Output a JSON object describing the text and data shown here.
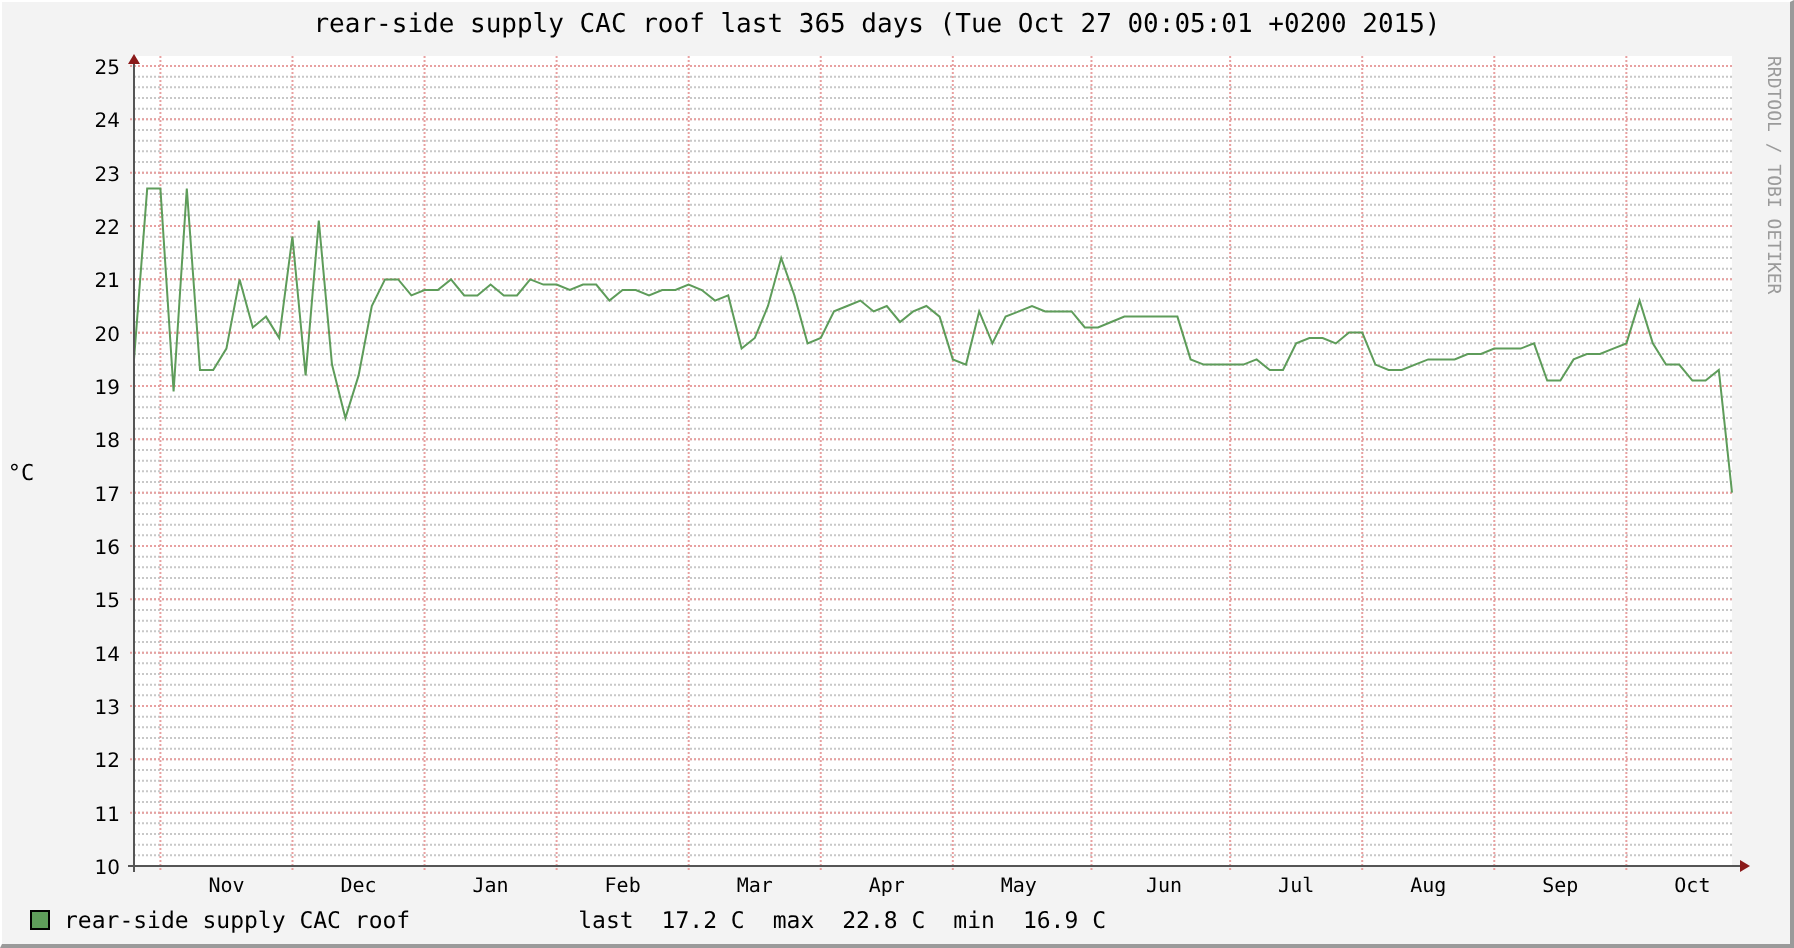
{
  "graph": {
    "credit": "RRDTOOL / TOBI OETIKER",
    "chart_data": {
      "type": "line",
      "title": "rear-side supply CAC roof last 365 days (Tue Oct 27 00:05:01 +0200 2015)",
      "ylabel": "°C",
      "grid": true,
      "categories": [
        null,
        null,
        null,
        null,
        null,
        null,
        null,
        "Nov",
        null,
        null,
        null,
        null,
        null,
        null,
        null,
        null,
        null,
        "Dec",
        null,
        null,
        null,
        null,
        null,
        null,
        null,
        null,
        null,
        "Jan",
        null,
        null,
        null,
        null,
        null,
        null,
        null,
        null,
        null,
        "Feb",
        null,
        null,
        null,
        null,
        null,
        null,
        null,
        null,
        null,
        "Mar",
        null,
        null,
        null,
        null,
        null,
        null,
        null,
        null,
        null,
        "Apr",
        null,
        null,
        null,
        null,
        null,
        null,
        null,
        null,
        null,
        "May",
        null,
        null,
        null,
        null,
        null,
        null,
        null,
        null,
        null,
        null,
        "Jun",
        null,
        null,
        null,
        null,
        null,
        null,
        null,
        null,
        null,
        "Jul",
        null,
        null,
        null,
        null,
        null,
        null,
        null,
        null,
        null,
        "Aug",
        null,
        null,
        null,
        null,
        null,
        null,
        null,
        null,
        null,
        "Sep",
        null,
        null,
        null,
        null,
        null,
        null,
        null,
        null,
        null,
        "Oct",
        null,
        null,
        null
      ],
      "series": [
        {
          "name": "rear-side supply CAC roof",
          "color": "#5e9c5a",
          "values": [
            19.5,
            22.7,
            22.7,
            18.9,
            22.7,
            19.3,
            19.3,
            19.7,
            21.0,
            20.1,
            20.3,
            19.9,
            21.8,
            19.2,
            22.1,
            19.4,
            18.4,
            19.2,
            20.5,
            21.0,
            21.0,
            20.7,
            20.8,
            20.8,
            21.0,
            20.7,
            20.7,
            20.9,
            20.7,
            20.7,
            21.0,
            20.9,
            20.9,
            20.8,
            20.9,
            20.9,
            20.6,
            20.8,
            20.8,
            20.7,
            20.8,
            20.8,
            20.9,
            20.8,
            20.6,
            20.7,
            19.7,
            19.9,
            20.5,
            21.4,
            20.7,
            19.8,
            19.9,
            20.4,
            20.5,
            20.6,
            20.4,
            20.5,
            20.2,
            20.4,
            20.5,
            20.3,
            19.5,
            19.4,
            20.4,
            19.8,
            20.3,
            20.4,
            20.5,
            20.4,
            20.4,
            20.4,
            20.1,
            20.1,
            20.2,
            20.3,
            20.3,
            20.3,
            20.3,
            20.3,
            19.5,
            19.4,
            19.4,
            19.4,
            19.4,
            19.5,
            19.3,
            19.3,
            19.8,
            19.9,
            19.9,
            19.8,
            20.0,
            20.0,
            19.4,
            19.3,
            19.3,
            19.4,
            19.5,
            19.5,
            19.5,
            19.6,
            19.6,
            19.7,
            19.7,
            19.7,
            19.8,
            19.1,
            19.1,
            19.5,
            19.6,
            19.6,
            19.7,
            19.8,
            20.6,
            19.8,
            19.4,
            19.4,
            19.1,
            19.1,
            19.3,
            17.0
          ]
        }
      ],
      "ylim": [
        10,
        25
      ],
      "yticks": [
        10,
        11,
        12,
        13,
        14,
        15,
        16,
        17,
        18,
        19,
        20,
        21,
        22,
        23,
        24,
        25
      ]
    },
    "legend": {
      "stats": [
        {
          "name": "last",
          "value": "17.2 C"
        },
        {
          "name": "max",
          "value": "22.8 C"
        },
        {
          "name": "min",
          "value": "16.9 C"
        }
      ]
    }
  }
}
